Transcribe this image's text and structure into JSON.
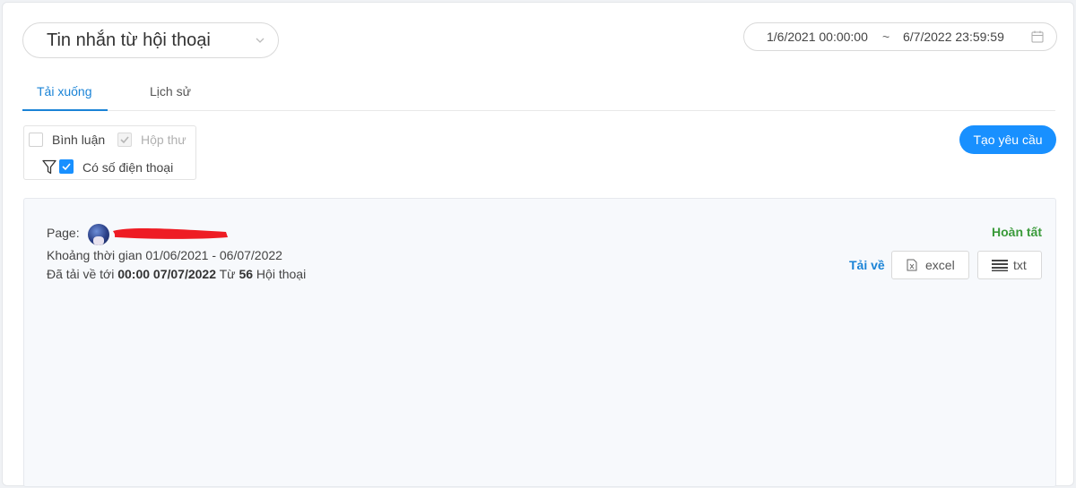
{
  "header": {
    "type_select": {
      "value": "Tin nhắn từ hội thoại",
      "icon": "chevron-down-icon"
    },
    "date_range": {
      "start": "1/6/2021 00:00:00",
      "separator": "~",
      "end": "6/7/2022 23:59:59",
      "icon": "calendar-icon"
    }
  },
  "tabs": [
    {
      "label": "Tải xuống",
      "active": true
    },
    {
      "label": "Lịch sử",
      "active": false
    }
  ],
  "filters": {
    "comments": {
      "label": "Bình luận",
      "checked": false
    },
    "inbox": {
      "label": "Hộp thư",
      "checked": true,
      "disabled": true
    },
    "has_phone": {
      "label": "Có số điện thoại",
      "checked": true
    },
    "filter_icon": "funnel-icon"
  },
  "actions": {
    "create_request": "Tạo yêu cầu"
  },
  "result": {
    "page_label": "Page:",
    "time_range_label": "Khoảng thời gian 01/06/2021 - 06/07/2022",
    "downloaded_prefix": "Đã tải về tới",
    "downloaded_time": "00:00 07/07/2022",
    "from_word": "Từ",
    "conversation_count": "56",
    "conversation_word": "Hội thoại",
    "status": "Hoàn tất",
    "download_label": "Tải về",
    "excel_button": "excel",
    "txt_button": "txt"
  },
  "colors": {
    "accent": "#1890ff",
    "tab_active": "#1a83d6",
    "status_done": "#3a9a3a",
    "redaction": "#ee1c24"
  }
}
